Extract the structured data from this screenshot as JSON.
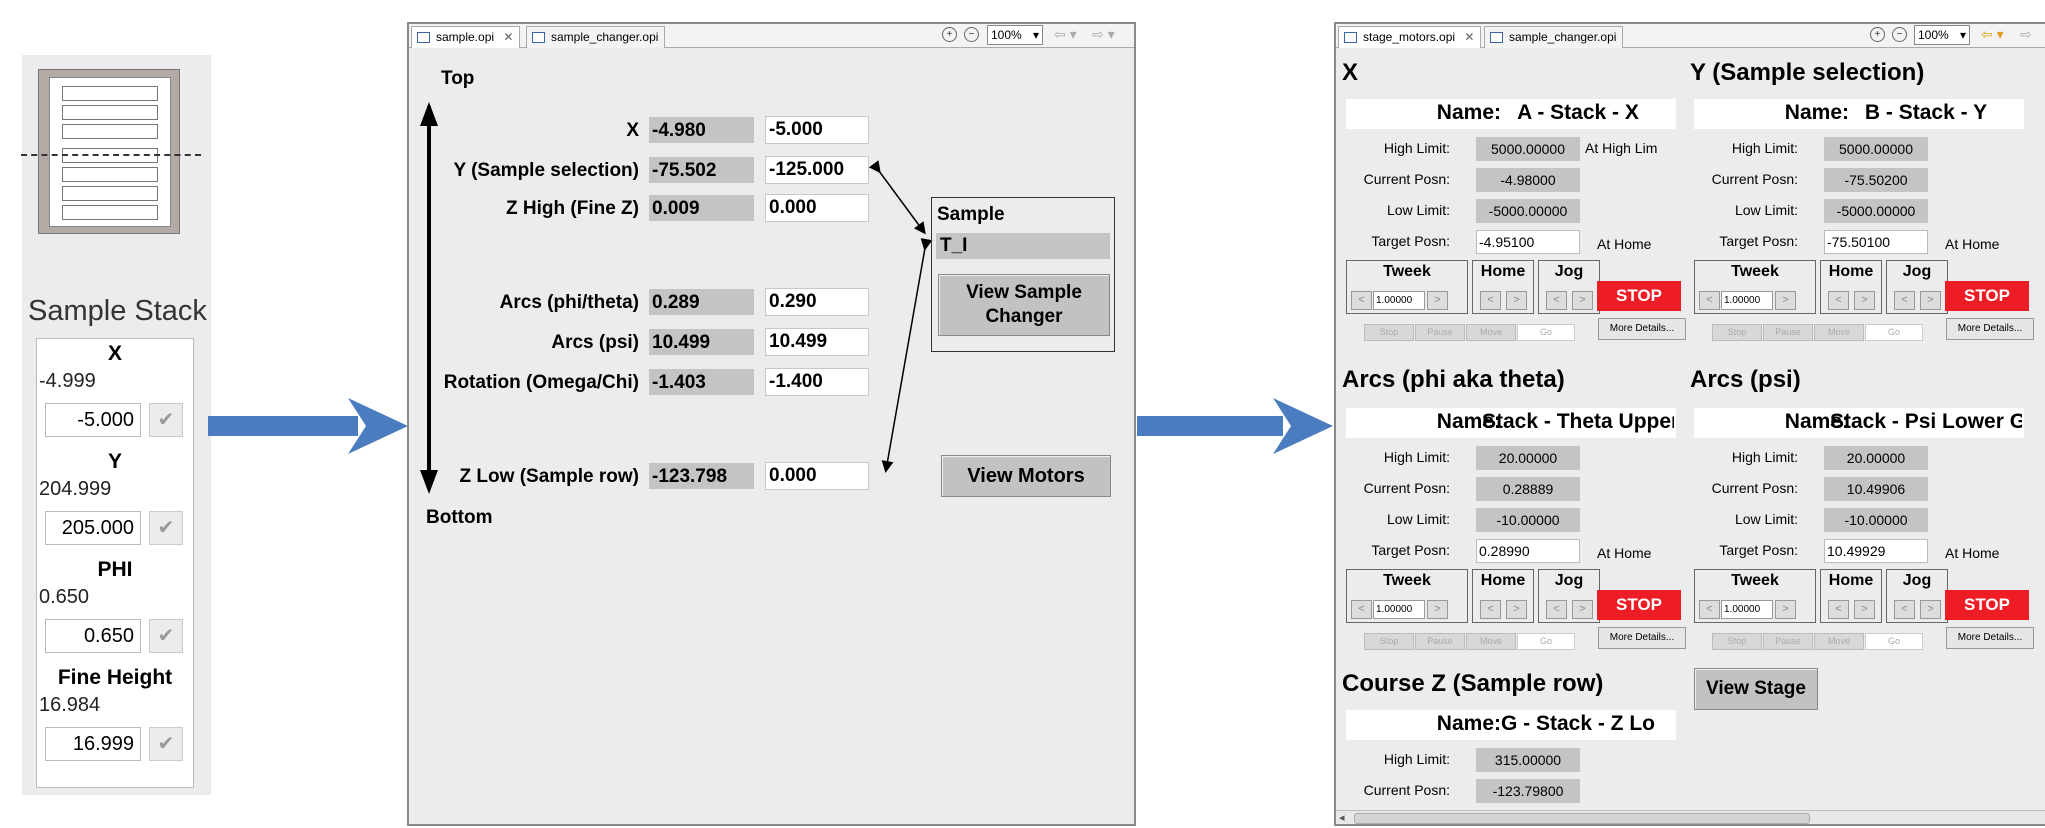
{
  "left_panel": {
    "title": "Sample Stack",
    "check_glyph": "✔",
    "rows": [
      {
        "name": "X",
        "readback": "-4.999",
        "setpoint": "-5.000"
      },
      {
        "name": "Y",
        "readback": "204.999",
        "setpoint": "205.000"
      },
      {
        "name": "PHI",
        "readback": "0.650",
        "setpoint": "0.650"
      },
      {
        "name": "Fine Height",
        "readback": "16.984",
        "setpoint": "16.999"
      }
    ]
  },
  "middle_window": {
    "tabs": [
      "sample.opi",
      "sample_changer.opi"
    ],
    "zoom": "100%",
    "top_label": "Top",
    "bottom_label": "Bottom",
    "axes": [
      {
        "label": "X",
        "readback": "-4.980",
        "setpoint": "-5.000"
      },
      {
        "label": "Y (Sample selection)",
        "readback": "-75.502",
        "setpoint": "-125.000"
      },
      {
        "label": "Z High (Fine Z)",
        "readback": "0.009",
        "setpoint": "0.000"
      },
      {
        "label": "Arcs (phi/theta)",
        "readback": "0.289",
        "setpoint": "0.290"
      },
      {
        "label": "Arcs (psi)",
        "readback": "10.499",
        "setpoint": "10.499"
      },
      {
        "label": "Rotation (Omega/Chi)",
        "readback": "-1.403",
        "setpoint": "-1.400"
      },
      {
        "label": "Z Low (Sample row)",
        "readback": "-123.798",
        "setpoint": "0.000"
      }
    ],
    "sample_box": {
      "title": "Sample",
      "value": "T_I",
      "button": "View Sample Changer"
    },
    "view_motors_button": "View Motors"
  },
  "right_window": {
    "tabs": [
      "stage_motors.opi",
      "sample_changer.opi"
    ],
    "zoom": "100%",
    "labels": {
      "name": "Name:",
      "high_limit": "High Limit:",
      "current_posn": "Current Posn:",
      "low_limit": "Low Limit:",
      "target_posn": "Target Posn:",
      "tweek": "Tweek",
      "home": "Home",
      "jog": "Jog",
      "stop": "STOP",
      "more_details": "More Details...",
      "stop_small": "Stop",
      "pause_small": "Pause",
      "move_small": "Move",
      "go_small": "Go"
    },
    "motors": [
      {
        "section": "X",
        "name": "A - Stack - X",
        "high_limit": "5000.00000",
        "current": "-4.98000",
        "low_limit": "-5000.00000",
        "target": "-4.95100",
        "status_high": "At High Lim",
        "status_home": "At Home",
        "tweek": "1.00000"
      },
      {
        "section": "Y (Sample selection)",
        "name": "B - Stack - Y",
        "high_limit": "5000.00000",
        "current": "-75.50200",
        "low_limit": "-5000.00000",
        "target": "-75.50100",
        "status_high": "",
        "status_home": "At Home",
        "tweek": "1.00000"
      },
      {
        "section": "Arcs (phi aka theta)",
        "name": "Stack - Theta Upper G",
        "high_limit": "20.00000",
        "current": "0.28889",
        "low_limit": "-10.00000",
        "target": "0.28990",
        "status_high": "",
        "status_home": "At Home",
        "tweek": "1.00000"
      },
      {
        "section": "Arcs (psi)",
        "name": "Stack - Psi Lower Go",
        "high_limit": "20.00000",
        "current": "10.49906",
        "low_limit": "-10.00000",
        "target": "10.49929",
        "status_high": "",
        "status_home": "At Home",
        "tweek": "1.00000"
      },
      {
        "section": "Course Z (Sample row)",
        "name": "G - Stack - Z Lo",
        "high_limit": "315.00000",
        "current": "-123.79800"
      }
    ],
    "view_stage_button": "View Stage"
  }
}
